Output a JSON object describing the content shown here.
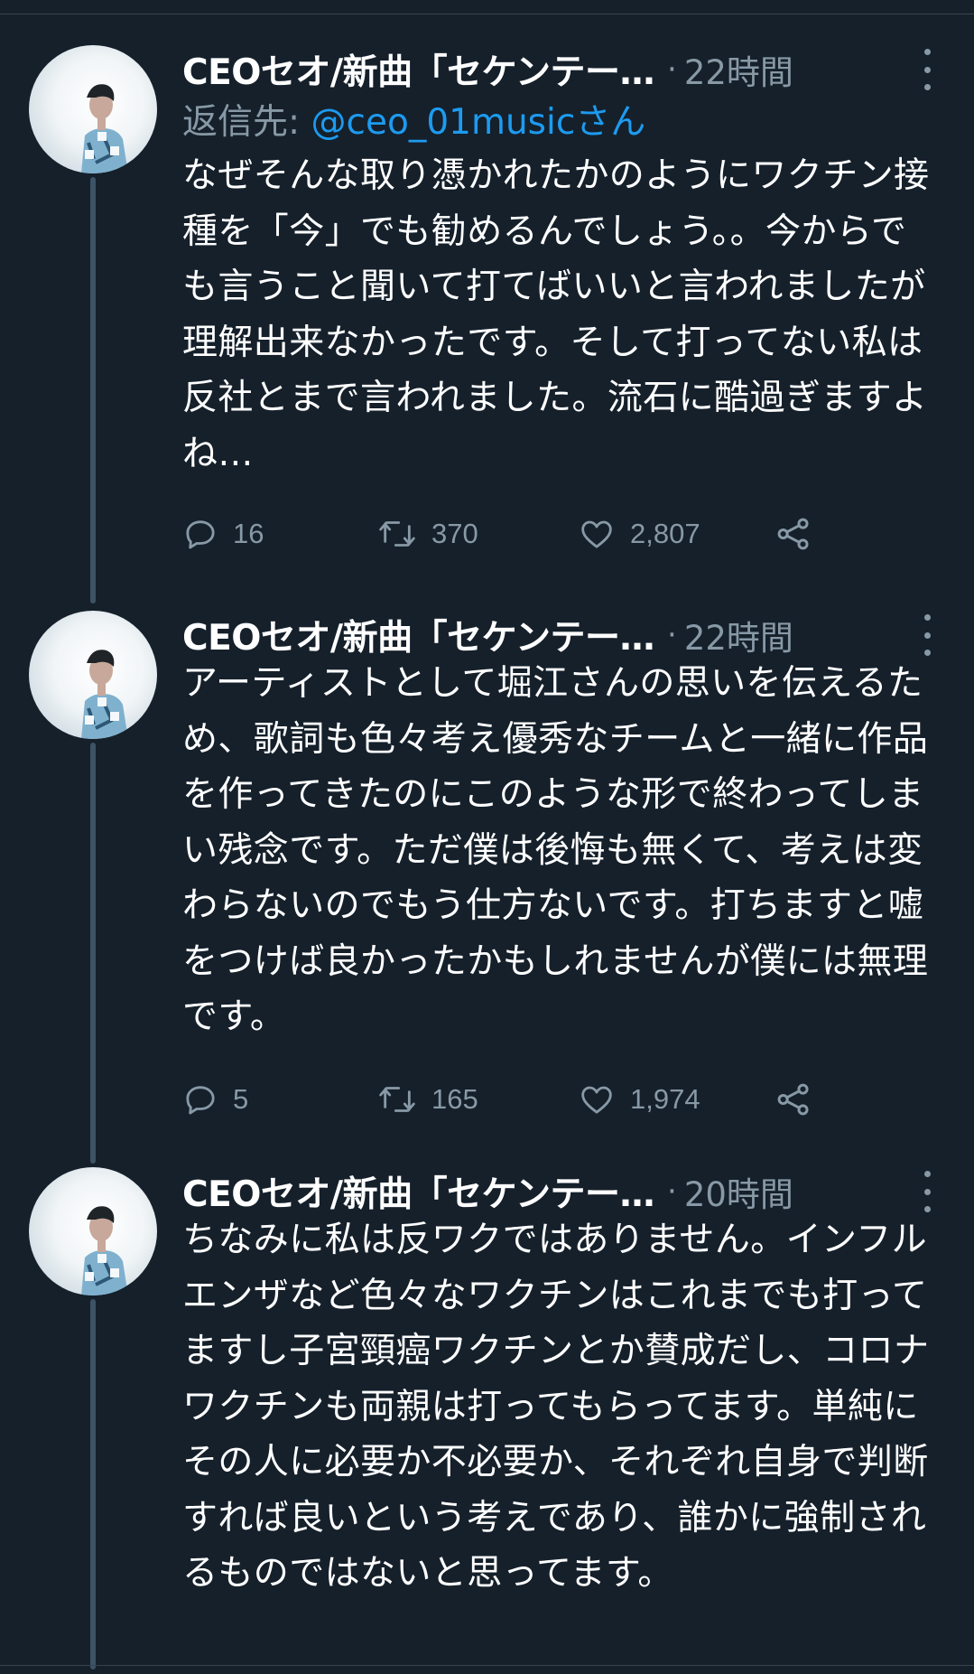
{
  "tweets": [
    {
      "author": "CEOセオ/新曲「セケンテー…",
      "separator": "·",
      "time": "22時間",
      "replying_label": "返信先: ",
      "replying_to": "@ceo_01musicさん",
      "text": "なぜそんな取り憑かれたかのようにワクチン接種を「今」でも勧めるんでしょう。。今からでも言うこと聞いて打てばいいと言われましたが理解出来なかったです。そして打ってない私は反社とまで言われました。流石に酷過ぎますよね…",
      "replies": "16",
      "retweets": "370",
      "likes": "2,807"
    },
    {
      "author": "CEOセオ/新曲「セケンテー…",
      "separator": "·",
      "time": "22時間",
      "text": "アーティストとして堀江さんの思いを伝えるため、歌詞も色々考え優秀なチームと一緒に作品を作ってきたのにこのような形で終わってしまい残念です。ただ僕は後悔も無くて、考えは変わらないのでもう仕方ないです。打ちますと嘘をつけば良かったかもしれませんが僕には無理です。",
      "replies": "5",
      "retweets": "165",
      "likes": "1,974"
    },
    {
      "author": "CEOセオ/新曲「セケンテー…",
      "separator": "·",
      "time": "20時間",
      "text": "ちなみに私は反ワクではありません。インフルエンザなど色々なワクチンはこれまでも打ってますし子宮頸癌ワクチンとか賛成だし、コロナワクチンも両親は打ってもらってます。単純にその人に必要か不必要か、それぞれ自身で判断すれば良いという考えであり、誰かに強制されるものではないと思ってます。"
    }
  ],
  "icons": {
    "reply": "reply-icon",
    "retweet": "retweet-icon",
    "like": "heart-icon",
    "share": "share-icon",
    "more": "more-vertical-icon"
  },
  "colors": {
    "background": "#15202b",
    "secondary_text": "#8899a6",
    "mention": "#1d9bf0",
    "thread_line": "#3d5366"
  }
}
